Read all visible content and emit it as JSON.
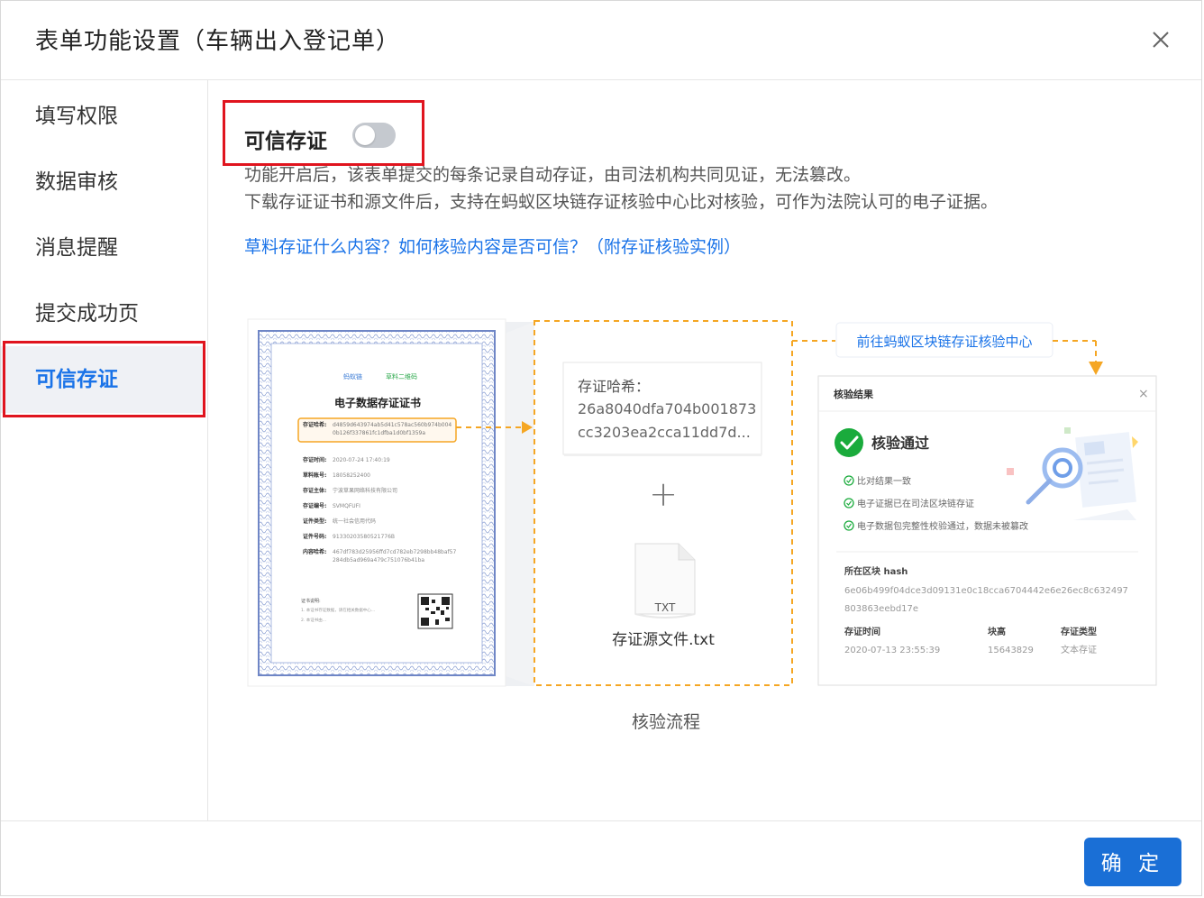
{
  "dialog": {
    "title": "表单功能设置（车辆出入登记单）",
    "confirm_label": "确 定"
  },
  "sidebar": {
    "items": [
      {
        "label": "填写权限",
        "active": false
      },
      {
        "label": "数据审核",
        "active": false
      },
      {
        "label": "消息提醒",
        "active": false
      },
      {
        "label": "提交成功页",
        "active": false
      },
      {
        "label": "可信存证",
        "active": true
      }
    ]
  },
  "main": {
    "toggle_label": "可信存证",
    "toggle_on": false,
    "desc_line1": "功能开启后，该表单提交的每条记录自动存证，由司法机构共同见证，无法篡改。",
    "desc_line2": "下载存证证书和源文件后，支持在蚂蚁区块链存证核验中心比对核验，可作为法院认可的电子证据。",
    "help_link": "草料存证什么内容？如何核验内容是否可信？（附存证核验实例）",
    "caption": "核验流程"
  },
  "illustration": {
    "cert": {
      "brand_left": "蚂蚁链",
      "brand_right": "草料二维码",
      "title": "电子数据存证证书",
      "hash_label": "存证哈希:",
      "hash_value_1": "d4859d643974ab5d41c578ac560b974b004",
      "hash_value_2": "0b126f337861fc1dfba1d0bf1359a",
      "rows": [
        {
          "label": "存证时间:",
          "value": "2020-07-24 17:40:19"
        },
        {
          "label": "草料账号:",
          "value": "18058252400"
        },
        {
          "label": "存证主体:",
          "value": "宁波草果网络科技有限公司"
        },
        {
          "label": "存证编号:",
          "value": "SVMQFUFI"
        },
        {
          "label": "证件类型:",
          "value": "统一社会信用代码"
        },
        {
          "label": "证件号码:",
          "value": "91330203580521776B"
        },
        {
          "label": "内容哈希:",
          "value": "467df783d25956ffd7cd782eb7298bb48baf57"
        },
        {
          "label": "",
          "value": "284db5ad969a479c751076b41ba"
        }
      ],
      "notes_title": "证书说明:",
      "notes_1": "1. 本证书存证数据，请在相关数据中心…",
      "notes_2": "2. 本证书由…"
    },
    "hash_box": {
      "label": "存证哈希：",
      "line1": "26a8040dfa704b001873",
      "line2": "cc3203ea2cca11dd7d..."
    },
    "plus": "+",
    "file_ext": "TXT",
    "file_name": "存证源文件.txt",
    "verify_link": "前往蚂蚁区块链存证核验中心",
    "result": {
      "title": "核验结果",
      "close": "×",
      "passed": "核验通过",
      "checks": [
        "比对结果一致",
        "电子证据已在司法区块链存证",
        "电子数据包完整性校验通过，数据未被篡改"
      ],
      "block_hash_label": "所在区块 hash",
      "block_hash_1": "6e06b499f04dce3d09131e0c18cca6704442e6e26ec8c632497",
      "block_hash_2": "803863eebd17e",
      "time_label": "存证时间",
      "time_value": "2020-07-13 23:55:39",
      "height_label": "块高",
      "height_value": "15643829",
      "type_label": "存证类型",
      "type_value": "文本存证"
    }
  },
  "colors": {
    "accent": "#1a73e8",
    "button": "#1a6fd6",
    "highlight_box": "#e0141e",
    "dashed_orange": "#f5a623",
    "success": "#1aab3c"
  }
}
